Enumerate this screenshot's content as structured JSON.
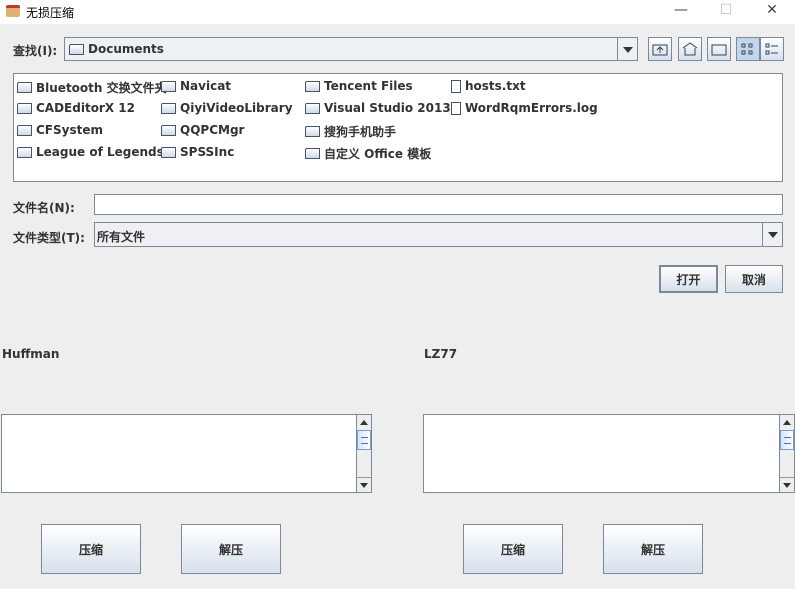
{
  "window": {
    "title": "无损压缩",
    "minimize": "—",
    "maximize": "☐",
    "close": "✕"
  },
  "chooser": {
    "look_in_label": "查找(I):",
    "look_in_value": "Documents",
    "toolbar": [
      "up-one-level",
      "home",
      "new-folder",
      "list-view",
      "details-view"
    ],
    "files": [
      {
        "name": "Bluetooth 交换文件夹",
        "type": "folder"
      },
      {
        "name": "CADEditorX 12",
        "type": "folder"
      },
      {
        "name": "CFSystem",
        "type": "folder"
      },
      {
        "name": "League of Legends",
        "type": "folder"
      },
      {
        "name": "Navicat",
        "type": "folder"
      },
      {
        "name": "QiyiVideoLibrary",
        "type": "folder"
      },
      {
        "name": "QQPCMgr",
        "type": "folder"
      },
      {
        "name": "SPSSInc",
        "type": "folder"
      },
      {
        "name": "Tencent Files",
        "type": "folder"
      },
      {
        "name": "Visual Studio 2013",
        "type": "folder"
      },
      {
        "name": "搜狗手机助手",
        "type": "folder"
      },
      {
        "name": "自定义 Office 模板",
        "type": "folder"
      },
      {
        "name": "hosts.txt",
        "type": "file"
      },
      {
        "name": "WordRqmErrors.log",
        "type": "file"
      }
    ],
    "filename_label": "文件名(N):",
    "filename_value": "",
    "filetype_label": "文件类型(T):",
    "filetype_value": "所有文件",
    "open": "打开",
    "cancel": "取消"
  },
  "huffman": {
    "label": "Huffman",
    "compress": "压缩",
    "decompress": "解压",
    "text": ""
  },
  "lz77": {
    "label": "LZ77",
    "compress": "压缩",
    "decompress": "解压",
    "text": ""
  }
}
